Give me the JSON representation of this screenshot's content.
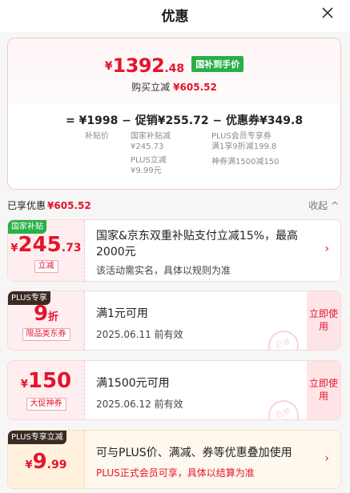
{
  "header": {
    "title": "优惠"
  },
  "price_card": {
    "currency": "¥",
    "final_int": "1392",
    "final_dec": ".48",
    "tag": "国补到手价",
    "save_label": "购买立减",
    "save_amount": "¥605.52",
    "formula": "= ¥1998 − 促销¥255.72 − 优惠券¥349.8",
    "sub_base": "补贴价",
    "sub_promo_1": "国家补贴减",
    "sub_promo_1_amt": "¥245.73",
    "sub_promo_2": "PLUS立减",
    "sub_promo_2_amt": "¥9.99元",
    "sub_coupon_1": "PLUS会员专享券",
    "sub_coupon_1_amt": "满1享9折减199.8",
    "sub_coupon_2": "神券满1500减150"
  },
  "enjoyed": {
    "label": "已享优惠",
    "amount": "¥605.52",
    "collapse": "收起 ^"
  },
  "coupons": [
    {
      "badge": "国家补贴",
      "badge_color": "#27b048",
      "currency": "¥",
      "big": "245",
      "dec": ".73",
      "label": "立减",
      "text": "国家&京东双重补贴支付立减15%，最高2000元",
      "sub": "该活动需实名，具体以规则为准",
      "action": "›"
    },
    {
      "badge": "PLUS专享",
      "badge_color": "#3a2c23",
      "big": "9",
      "unit": "折",
      "label": "限品类东券",
      "text": "满1元可用",
      "sub": "2025.06.11 前有效",
      "action": "立即使用",
      "stamp": "已领"
    },
    {
      "badge": "",
      "currency": "¥",
      "big": "150",
      "label": "大促神券",
      "text": "满1500元可用",
      "sub": "2025.06.12 前有效",
      "action": "立即使用",
      "stamp": "已领"
    },
    {
      "badge": "PLUS专享立减",
      "badge_color": "#3a2c23",
      "currency": "¥",
      "big": "9",
      "dec": ".99",
      "text": "可与PLUS价、满减、券等优惠叠加使用",
      "sub": "PLUS正式会员可享，具体以结算为准",
      "action": "›"
    }
  ],
  "colors": {
    "accent": "#e4142d",
    "green": "#27b048",
    "card_pink": "#ffeef0"
  }
}
